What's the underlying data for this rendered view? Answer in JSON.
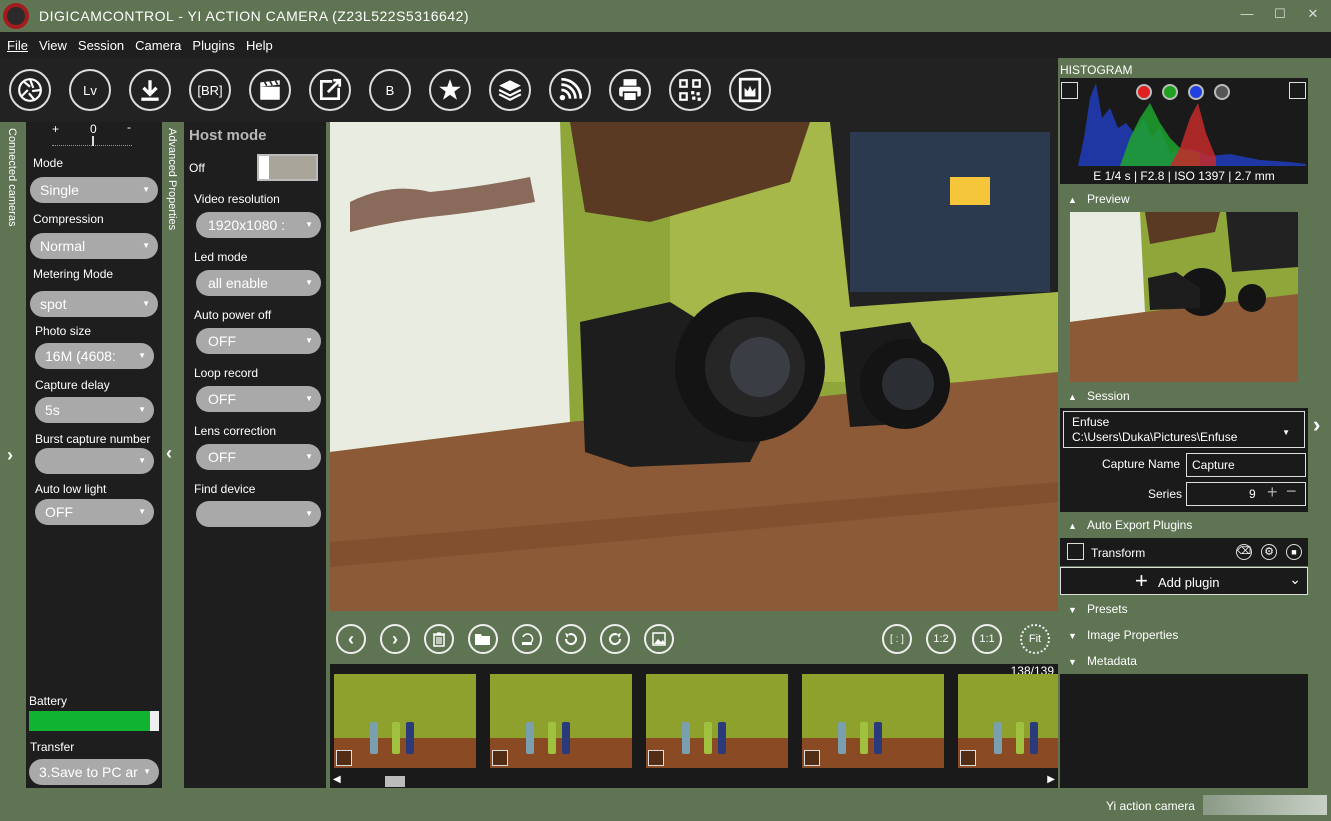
{
  "window": {
    "title": "DIGICAMCONTROL - YI ACTION CAMERA (Z23L522S5316642)",
    "minimize": "—",
    "maximize": "☐",
    "close": "✕"
  },
  "menu": [
    "File",
    "View",
    "Session",
    "Camera",
    "Plugins",
    "Help"
  ],
  "toolbar": {
    "lv_label": "Lv",
    "br_label": "[BR]",
    "b_label": "B",
    "icons": [
      "aperture-icon",
      "live-view",
      "download-icon",
      "bracketing",
      "clapper-icon",
      "export-icon",
      "b-mode",
      "star-icon",
      "layers-icon",
      "wifi-icon",
      "printer-icon",
      "qr-code-icon",
      "image-frame-icon"
    ]
  },
  "left_strip": {
    "label": "Connected cameras"
  },
  "exposure": {
    "plus": "+",
    "zero": "0",
    "minus": "-"
  },
  "camera_props": [
    {
      "label": "Mode",
      "value": "Single"
    },
    {
      "label": "Compression",
      "value": "Normal"
    },
    {
      "label": "Metering Mode",
      "value": "spot"
    },
    {
      "label": "Photo size",
      "value": "16M (4608:"
    },
    {
      "label": "Capture delay",
      "value": "5s"
    },
    {
      "label": "Burst capture number",
      "value": ""
    },
    {
      "label": "Auto low light",
      "value": "OFF"
    }
  ],
  "battery": {
    "label": "Battery",
    "level": 0.93,
    "color": "#10b431"
  },
  "transfer": {
    "label": "Transfer",
    "value": "3.Save to PC ar"
  },
  "adv_strip": {
    "label": "Advanced Properties"
  },
  "advanced": {
    "host_mode_title": "Host mode",
    "host_mode_state": "Off",
    "props": [
      {
        "label": "Video resolution",
        "value": "1920x1080 :"
      },
      {
        "label": "Led mode",
        "value": "all enable"
      },
      {
        "label": "Auto power off",
        "value": "OFF"
      },
      {
        "label": "Loop record",
        "value": "OFF"
      },
      {
        "label": "Lens correction",
        "value": "OFF"
      },
      {
        "label": "Find device",
        "value": ""
      }
    ]
  },
  "viewer": {
    "zoom_buttons": [
      "[ : ]",
      "1:2",
      "1:1",
      "Fit"
    ],
    "counter": "138/139"
  },
  "right": {
    "histogram_title": "HISTOGRAM",
    "exposure_info": "E 1/4 s | F2.8 | ISO 1397 | 2.7 mm",
    "preview_title": "Preview",
    "session_title": "Session",
    "session_name": "Enfuse",
    "session_path": "C:\\Users\\Duka\\Pictures\\Enfuse",
    "capture_name_label": "Capture Name",
    "capture_name_value": "Capture",
    "series_label": "Series",
    "series_value": "9",
    "auto_export_title": "Auto Export Plugins",
    "transform_label": "Transform",
    "add_plugin_label": "Add plugin",
    "presets_title": "Presets",
    "image_properties_title": "Image Properties",
    "metadata_title": "Metadata"
  },
  "status": {
    "camera_name": "Yi action camera"
  },
  "colors": {
    "accent_green": "#5f7453",
    "panel_dark": "#1e1e1e",
    "dropdown_gray": "#a9a9a9"
  }
}
